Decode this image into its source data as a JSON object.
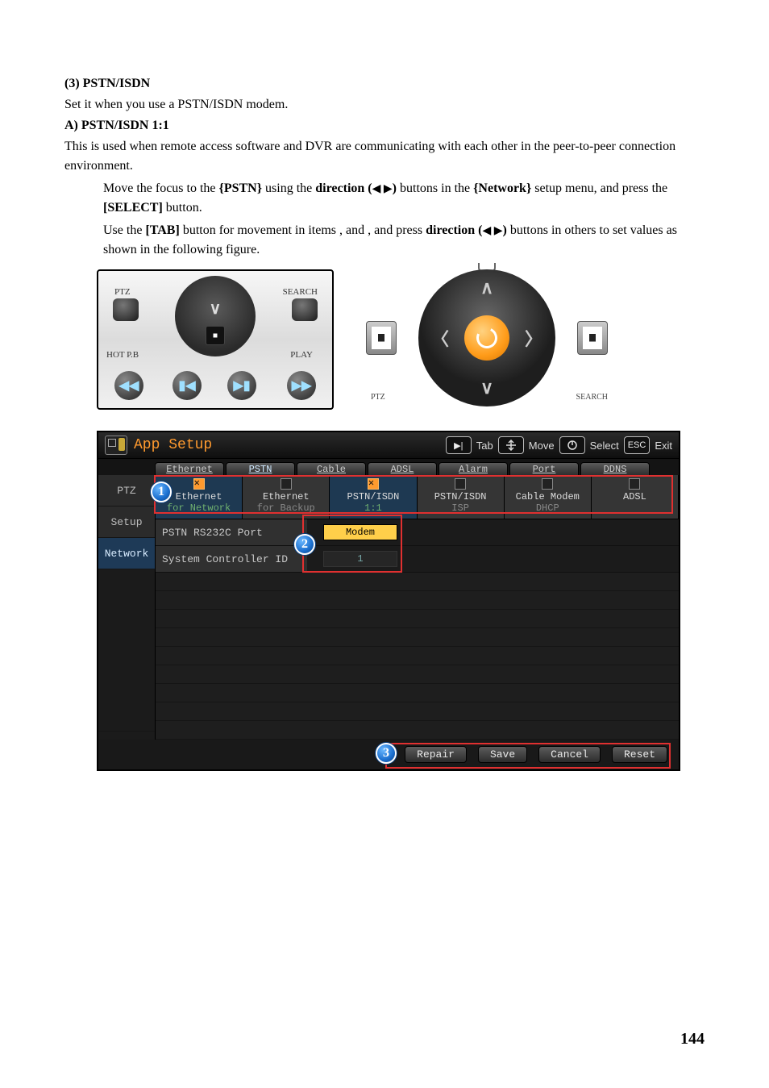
{
  "doc": {
    "h3": "(3)  PSTN/ISDN",
    "p1": "Set it when you use a PSTN/ISDN modem.",
    "hA": "A)  PSTN/ISDN 1:1",
    "p2": "This is used when remote access software and DVR are communicating with each other in the peer-to-peer connection environment.",
    "b1a": "Move the focus to the ",
    "b1b": "{PSTN}",
    "b1c": " using the ",
    "b1d": "direction (",
    "b1e": ")",
    "b1f": " buttons in the ",
    "b1g": "{Network}",
    "b1h": " setup menu, and press the ",
    "b1i": "[SELECT]",
    "b1j": " button.",
    "b2a": "Use the ",
    "b2b": "[TAB]",
    "b2c": " button for movement in items    ,       and    , and press ",
    "b2d": "direction (",
    "b2e": ")",
    "b2f": " buttons in others to set values as shown in the following figure.",
    "arrows_lr": "◀ ▶"
  },
  "rc1": {
    "ptz": "PTZ",
    "search": "SEARCH",
    "hot": "HOT P.B",
    "play": "PLAY",
    "b1": "◀◀",
    "b2": "▮◀",
    "b3": "▶▮",
    "b4": "▶▶",
    "v": "∨"
  },
  "rc2": {
    "ptz": "PTZ",
    "search": "SEARCH",
    "up": "∧",
    "down": "∨",
    "left": "〈",
    "right": "〉"
  },
  "app": {
    "title": "App Setup",
    "hints": {
      "tab": "Tab",
      "move": "Move",
      "select": "Select",
      "exit": "Exit",
      "escKey": "ESC",
      "tabGlyph": "▶|"
    },
    "tabs": [
      "Ethernet",
      "PSTN",
      "Cable",
      "ADSL",
      "Alarm",
      "Port",
      "DDNS"
    ],
    "activeTab": 1,
    "sidebar": {
      "items": [
        "PTZ",
        "Setup",
        "Network"
      ],
      "active": 2
    },
    "opts": [
      {
        "l1": "Ethernet",
        "l2": "for Network",
        "sel": true
      },
      {
        "l1": "Ethernet",
        "l2": "for Backup",
        "sel": false
      },
      {
        "l1": "PSTN/ISDN",
        "l2": "1:1",
        "sel": true
      },
      {
        "l1": "PSTN/ISDN",
        "l2": "ISP",
        "sel": false
      },
      {
        "l1": "Cable Modem",
        "l2": "DHCP",
        "sel": false
      },
      {
        "l1": "ADSL",
        "l2": "",
        "sel": false
      }
    ],
    "rows": [
      {
        "label": "PSTN RS232C Port",
        "value": "Modem",
        "hl": true
      },
      {
        "label": "System Controller ID",
        "value": "1",
        "hl": false
      }
    ],
    "buttons": [
      "Repair",
      "Save",
      "Cancel",
      "Reset"
    ]
  },
  "callouts": {
    "c1": "1",
    "c2": "2",
    "c3": "3"
  },
  "pagenum": "144"
}
